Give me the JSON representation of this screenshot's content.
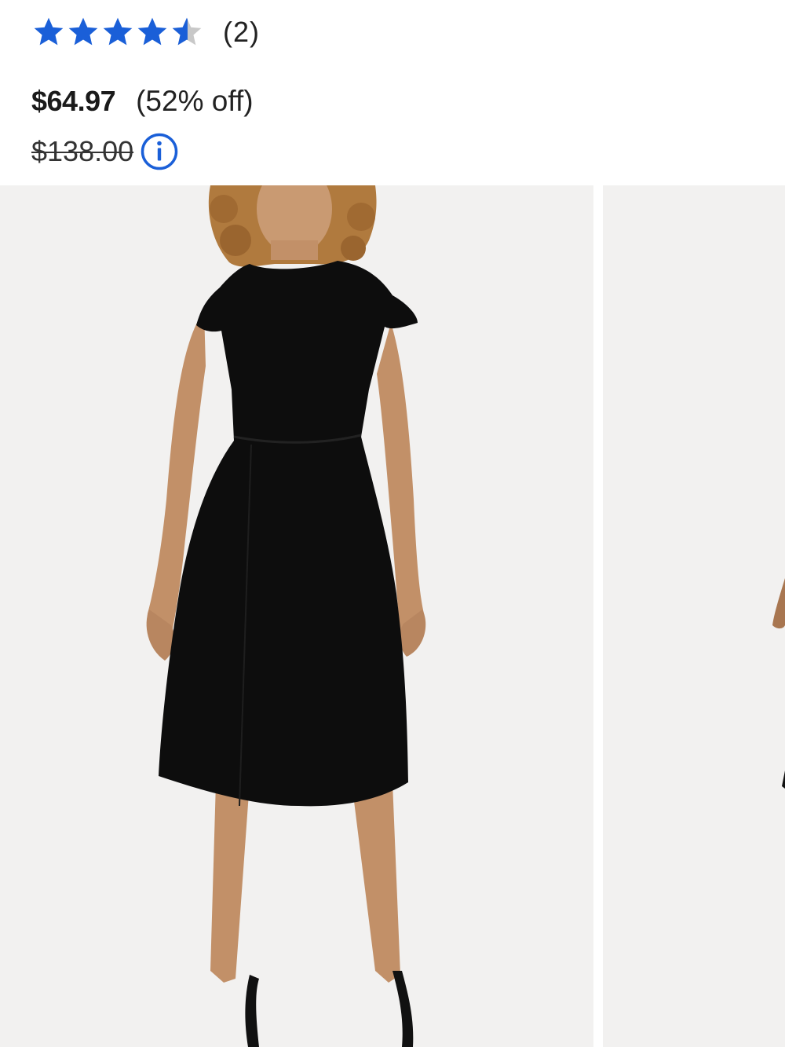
{
  "product": {
    "rating": {
      "value": 4.5,
      "max": 5,
      "review_count": "(2)",
      "star_color": "#1a5fd8",
      "empty_star_color": "#c8c8c8"
    },
    "price": {
      "sale": "$64.97",
      "discount": "(52% off)",
      "original": "$138.00"
    },
    "info_icon": "info-circle-icon",
    "accent_color": "#1a5fd8",
    "gallery": {
      "images": [
        {
          "subject": "model-black-dress-front"
        },
        {
          "subject": "model-black-dress-partial"
        }
      ]
    }
  }
}
